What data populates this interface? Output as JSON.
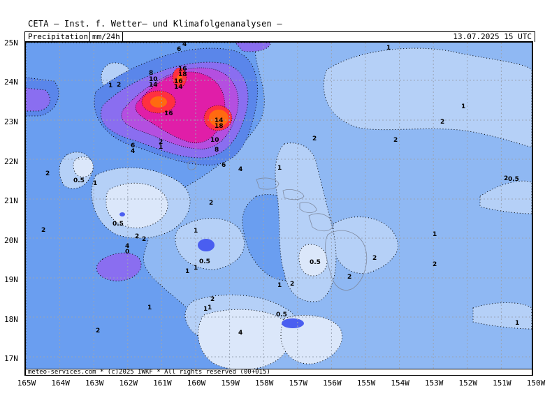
{
  "header": {
    "title": "CETA — Inst. f. Wetter— und Klimafolgenanalysen —"
  },
  "subheader": {
    "parameter": "Precipitation",
    "unit": "mm/24h",
    "valid_time": "13.07.2025 15 UTC"
  },
  "footer": {
    "credit": "meteo-services.com * (c)2025 IWKF * All rights reserved (00+015)"
  },
  "axes": {
    "latitude_labels": [
      "25N",
      "24N",
      "23N",
      "22N",
      "21N",
      "20N",
      "19N",
      "18N",
      "17N"
    ],
    "longitude_labels": [
      "165W",
      "164W",
      "163W",
      "162W",
      "161W",
      "160W",
      "159W",
      "158W",
      "157W",
      "156W",
      "155W",
      "154W",
      "153W",
      "152W",
      "151W",
      "150W"
    ]
  },
  "map": {
    "grid": "dotted lat/lon lines every 1 degree",
    "colors": {
      "c_0_5": "#dbe7fa",
      "c_1": "#b5d0f7",
      "c_2": "#8fb8f3",
      "c_4": "#6a9ef0",
      "c_6": "#5a86ea",
      "c_violet": "#8a6ef0",
      "c_purple": "#b44fe0",
      "c_magenta": "#e01ea8",
      "c_red": "#ff3040",
      "c_orange": "#ff6a10",
      "coast": "#7f8aa0"
    },
    "contour_labels": [
      {
        "text": "4"
      },
      {
        "text": "6"
      },
      {
        "text": "8"
      },
      {
        "text": "10"
      },
      {
        "text": "14"
      },
      {
        "text": "16"
      },
      {
        "text": "18"
      },
      {
        "text": "16"
      },
      {
        "text": "14"
      },
      {
        "text": "16"
      },
      {
        "text": "14"
      },
      {
        "text": "18"
      },
      {
        "text": "10"
      },
      {
        "text": "8"
      },
      {
        "text": "6"
      },
      {
        "text": "4"
      },
      {
        "text": "2"
      },
      {
        "text": "1"
      },
      {
        "text": "1"
      },
      {
        "text": "2"
      },
      {
        "text": "6"
      },
      {
        "text": "4"
      },
      {
        "text": "2"
      },
      {
        "text": "0.5"
      },
      {
        "text": "1"
      },
      {
        "text": "1"
      },
      {
        "text": "2"
      },
      {
        "text": "1"
      },
      {
        "text": "0.5"
      },
      {
        "text": "2"
      },
      {
        "text": "2"
      },
      {
        "text": "1"
      },
      {
        "text": "2"
      },
      {
        "text": "4"
      },
      {
        "text": "0"
      },
      {
        "text": "1"
      },
      {
        "text": "0.5"
      },
      {
        "text": "2"
      },
      {
        "text": "0.5"
      },
      {
        "text": "1"
      },
      {
        "text": "2"
      },
      {
        "text": "2"
      },
      {
        "text": "2"
      },
      {
        "text": "1"
      },
      {
        "text": "2"
      },
      {
        "text": "1"
      },
      {
        "text": "0.5"
      },
      {
        "text": "0.5"
      },
      {
        "text": "4"
      },
      {
        "text": "2"
      },
      {
        "text": "1"
      },
      {
        "text": "1"
      },
      {
        "text": "2"
      },
      {
        "text": "2"
      },
      {
        "text": "1"
      },
      {
        "text": "2"
      },
      {
        "text": "2"
      },
      {
        "text": "1"
      },
      {
        "text": "1"
      }
    ]
  }
}
